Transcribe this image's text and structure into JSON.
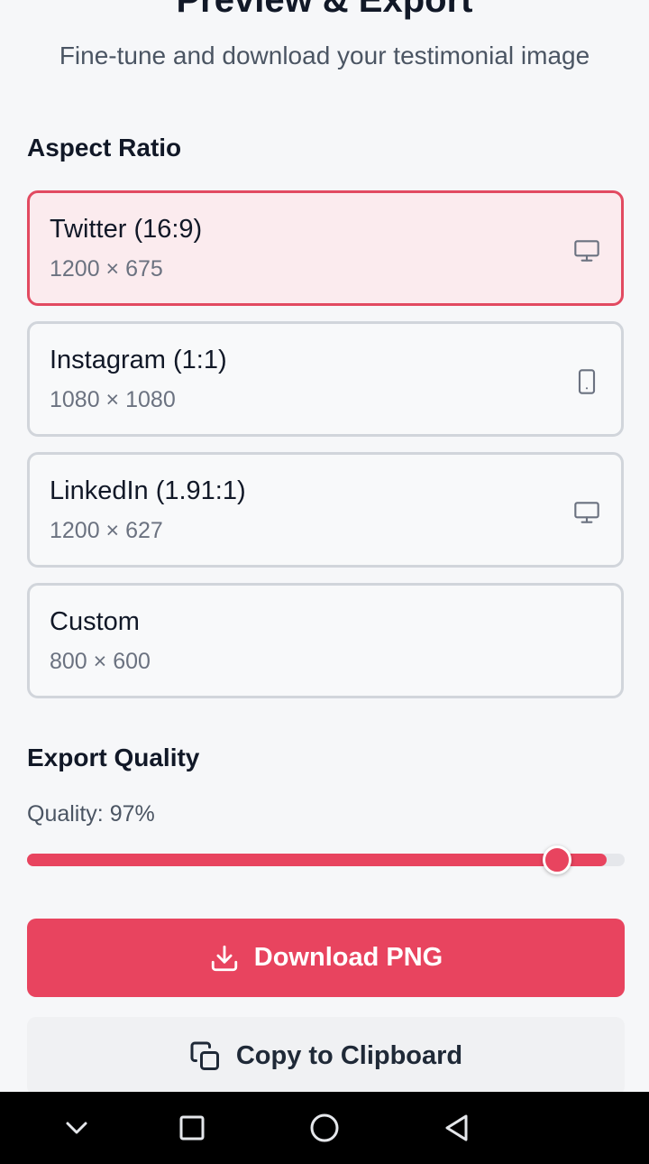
{
  "header": {
    "title": "Preview & Export",
    "subtitle": "Fine-tune and download your testimonial image"
  },
  "aspect_ratio": {
    "heading": "Aspect Ratio",
    "options": [
      {
        "name": "Twitter (16:9)",
        "dims": "1200 × 675",
        "icon": "monitor-icon",
        "selected": true
      },
      {
        "name": "Instagram (1:1)",
        "dims": "1080 × 1080",
        "icon": "tablet-icon",
        "selected": false
      },
      {
        "name": "LinkedIn (1.91:1)",
        "dims": "1200 × 627",
        "icon": "monitor-icon",
        "selected": false
      },
      {
        "name": "Custom",
        "dims": "800 × 600",
        "icon": "",
        "selected": false
      }
    ]
  },
  "export_quality": {
    "heading": "Export Quality",
    "label": "Quality: 97%",
    "value_percent": 97
  },
  "actions": {
    "download_label": "Download PNG",
    "copy_label": "Copy to Clipboard"
  },
  "colors": {
    "accent": "#e8445f",
    "selected_border": "#e24a61",
    "selected_bg": "#fbebee"
  }
}
